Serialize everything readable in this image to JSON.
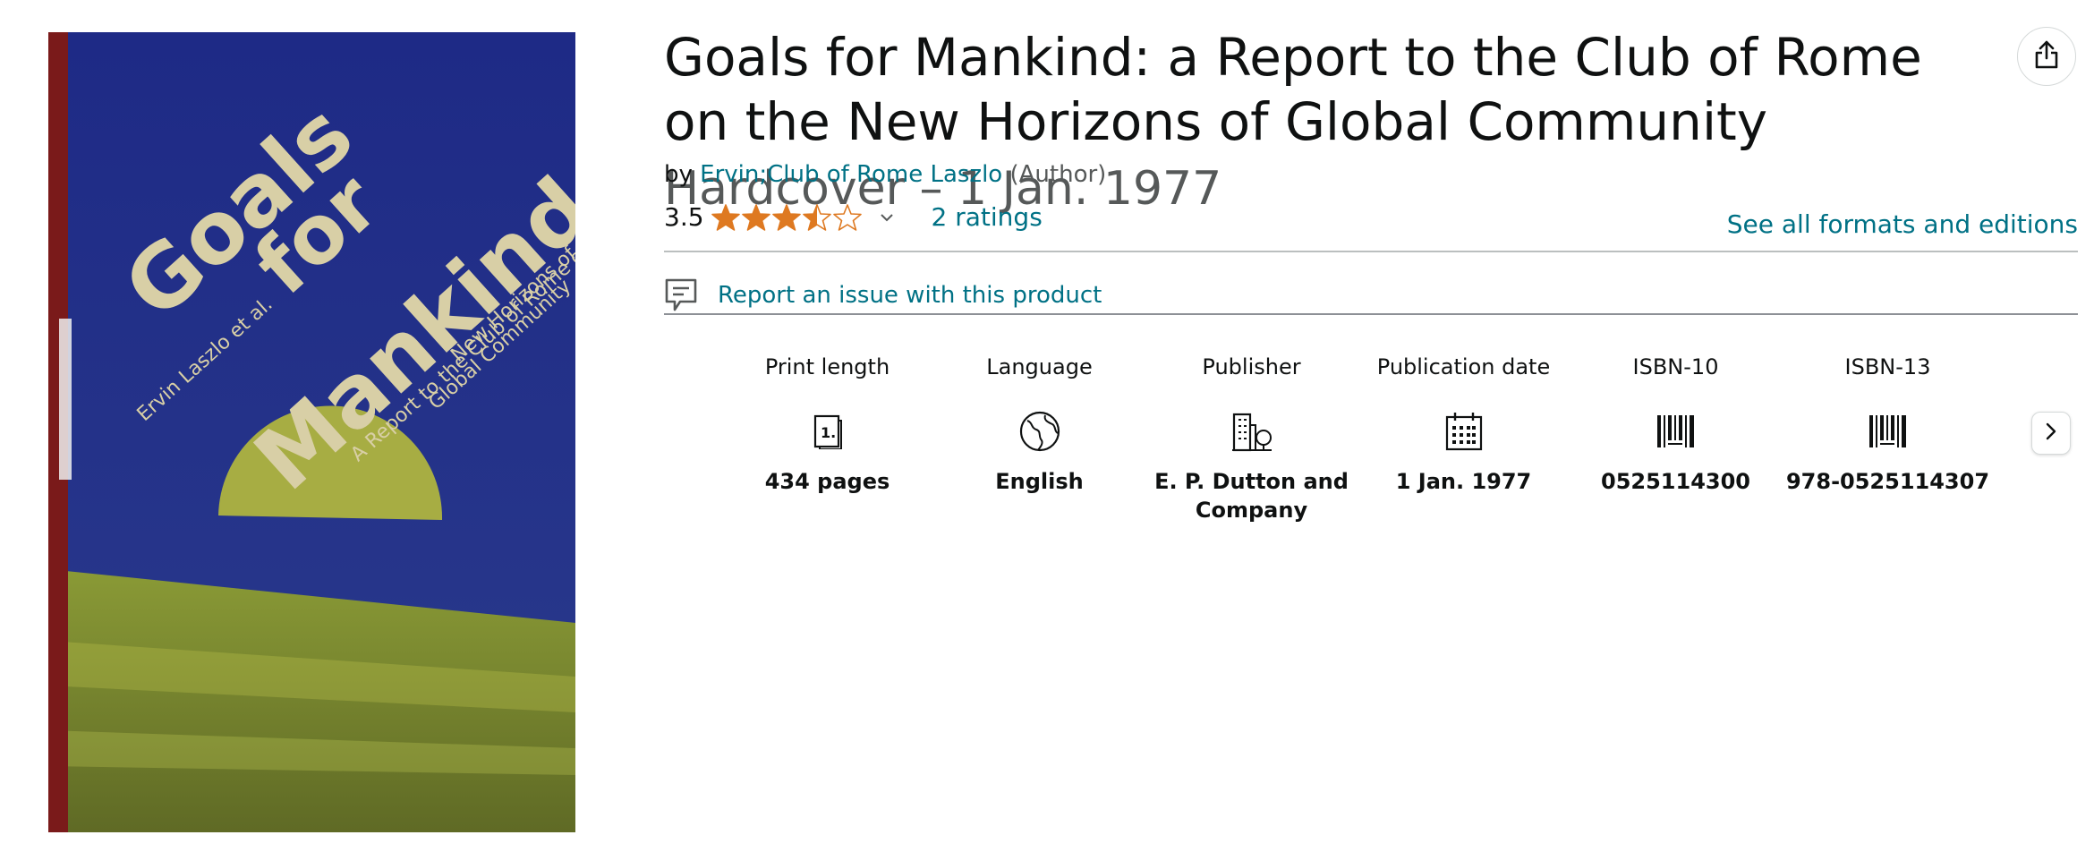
{
  "cover": {
    "title_line1": "Goals",
    "title_line2": "for",
    "title_line3": "Mankind",
    "authors": "Ervin Laszlo et al.",
    "subtitle1": "A Report to the Club of Rome on the",
    "subtitle2": "New Horizons of",
    "subtitle3": "Global Community"
  },
  "product": {
    "title": "Goals for Mankind: a Report to the Club of Rome on the New Horizons of Global Community",
    "format": "Hardcover – 1 Jan. 1977",
    "by_label": "by",
    "author": "Ervin;Club of Rome Laszlo",
    "author_role": "(Author)",
    "rating_value": "3.5",
    "rating_stars": 3.5,
    "ratings_count": "2 ratings",
    "see_formats": "See all formats and editions",
    "report_issue": "Report an issue with this product"
  },
  "details": [
    {
      "label": "Print length",
      "icon": "document-page-icon",
      "value": "434 pages"
    },
    {
      "label": "Language",
      "icon": "globe-icon",
      "value": "English"
    },
    {
      "label": "Publisher",
      "icon": "building-icon",
      "value": "E. P. Dutton and Company"
    },
    {
      "label": "Publication date",
      "icon": "calendar-icon",
      "value": "1 Jan. 1977"
    },
    {
      "label": "ISBN-10",
      "icon": "barcode-icon",
      "value": "0525114300"
    },
    {
      "label": "ISBN-13",
      "icon": "barcode-icon",
      "value": "978-0525114307"
    }
  ],
  "colors": {
    "link": "#007185",
    "star": "#de7921",
    "text": "#0f1111",
    "muted": "#565959"
  }
}
